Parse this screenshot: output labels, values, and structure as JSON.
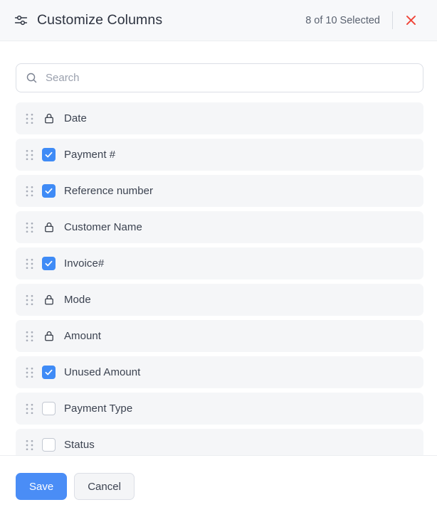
{
  "header": {
    "icon": "sliders-icon",
    "title": "Customize Columns",
    "selected_text": "8 of 10 Selected",
    "close_icon": "close-icon",
    "background_color": "#f7f8fa"
  },
  "search": {
    "icon": "search-icon",
    "placeholder": "Search",
    "value": ""
  },
  "columns": [
    {
      "label": "Date",
      "control": "lock",
      "checked": false,
      "locked": true
    },
    {
      "label": "Payment #",
      "control": "checkbox",
      "checked": true,
      "locked": false
    },
    {
      "label": "Reference number",
      "control": "checkbox",
      "checked": true,
      "locked": false
    },
    {
      "label": "Customer Name",
      "control": "lock",
      "checked": false,
      "locked": true
    },
    {
      "label": "Invoice#",
      "control": "checkbox",
      "checked": true,
      "locked": false
    },
    {
      "label": "Mode",
      "control": "lock",
      "checked": false,
      "locked": true
    },
    {
      "label": "Amount",
      "control": "lock",
      "checked": false,
      "locked": true
    },
    {
      "label": "Unused Amount",
      "control": "checkbox",
      "checked": true,
      "locked": false
    },
    {
      "label": "Payment Type",
      "control": "checkbox",
      "checked": false,
      "locked": false
    },
    {
      "label": "Status",
      "control": "checkbox",
      "checked": false,
      "locked": false
    }
  ],
  "footer": {
    "save_label": "Save",
    "cancel_label": "Cancel"
  },
  "colors": {
    "accent": "#4a8df6",
    "checkbox_checked": "#3f8bf6",
    "close_red": "#f04438",
    "row_background": "#f5f6f8",
    "text": "#3b4250"
  }
}
